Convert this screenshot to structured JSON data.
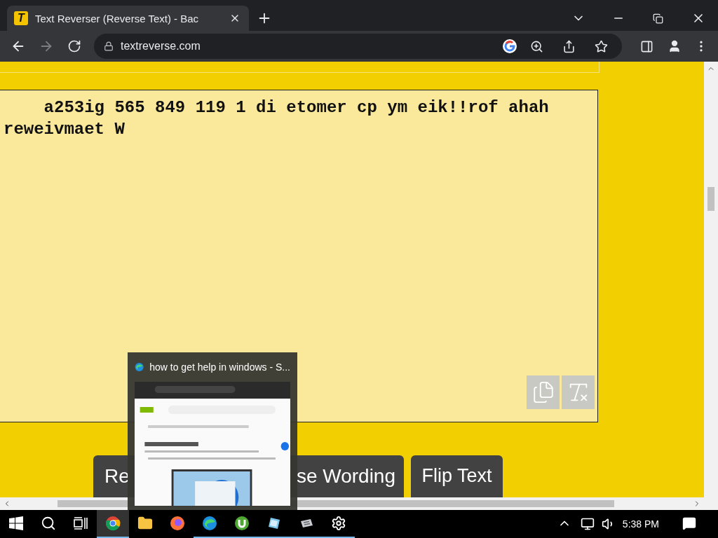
{
  "browser": {
    "tab": {
      "favicon": "T",
      "title": "Text Reverser (Reverse Text) - Bac",
      "selected": true
    },
    "url": "textreverse.com"
  },
  "page": {
    "output": {
      "lines": [
        "    a253ig 565 849 119 1 di etomer cp ym eik!!rof ahah",
        "reweivmaet W"
      ]
    },
    "buttons": [
      {
        "label": "Re"
      },
      {
        "label": "se Wording"
      },
      {
        "label": "Flip Text"
      }
    ]
  },
  "preview": {
    "title": "how to get help in windows - S..."
  },
  "taskbar": {
    "apps": [
      {
        "kind": "chrome",
        "selected": true,
        "running": true
      },
      {
        "kind": "explorer",
        "selected": false,
        "running": false
      },
      {
        "kind": "firefox",
        "selected": false,
        "running": false
      },
      {
        "kind": "edge",
        "selected": false,
        "running": true
      },
      {
        "kind": "utorrent",
        "selected": false,
        "running": true
      },
      {
        "kind": "notepad",
        "selected": false,
        "running": true
      },
      {
        "kind": "terminal",
        "selected": false,
        "running": true
      },
      {
        "kind": "settings",
        "selected": false,
        "running": true
      }
    ],
    "clock": "5:38 PM"
  }
}
